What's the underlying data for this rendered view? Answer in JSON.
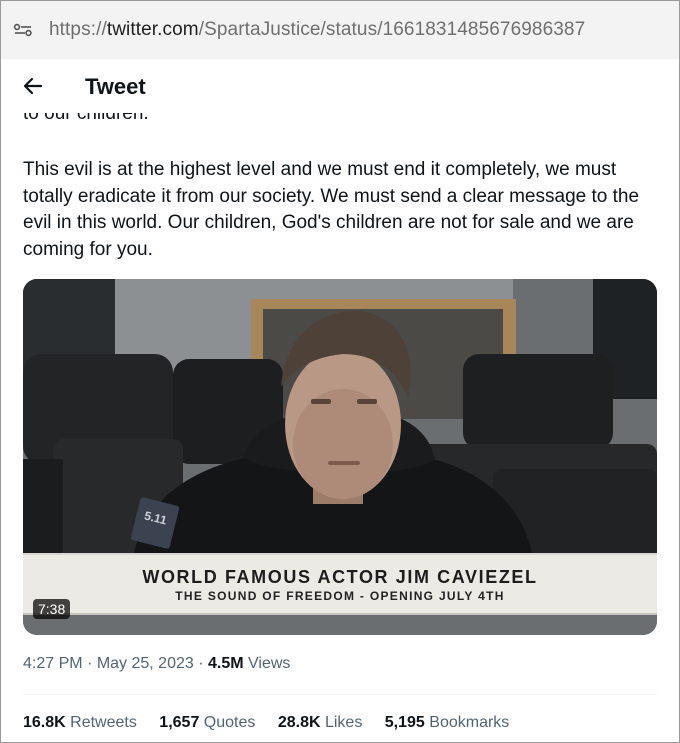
{
  "browser": {
    "url_prefix": "https://",
    "url_host": "twitter.com",
    "url_path": "/SpartaJustice/status/1661831485676986387",
    "site_info_icon": "site-info-icon"
  },
  "header": {
    "back_icon": "arrow-left-icon",
    "title": "Tweet"
  },
  "tweet": {
    "cut_line": "to our children.",
    "text": "This evil is at the highest level and we must end it completely, we must totally eradicate it from our society. We must send a clear message to the evil in this world. Our children, God's children are not for sale and we are coming for you.",
    "media": {
      "banner_line1": "WORLD FAMOUS ACTOR JIM CAVIEZEL",
      "banner_line2": "THE SOUND OF FREEDOM - OPENING JULY 4TH",
      "patch_text": "5.11",
      "duration": "7:38"
    },
    "meta": {
      "time": "4:27 PM",
      "sep1": " · ",
      "date": "May 25, 2023",
      "sep2": " · ",
      "views_count": "4.5M",
      "views_label": " Views"
    },
    "stats": {
      "retweets_count": "16.8K",
      "retweets_label": " Retweets",
      "quotes_count": "1,657",
      "quotes_label": " Quotes",
      "likes_count": "28.8K",
      "likes_label": " Likes",
      "bookmarks_count": "5,195",
      "bookmarks_label": " Bookmarks"
    }
  }
}
